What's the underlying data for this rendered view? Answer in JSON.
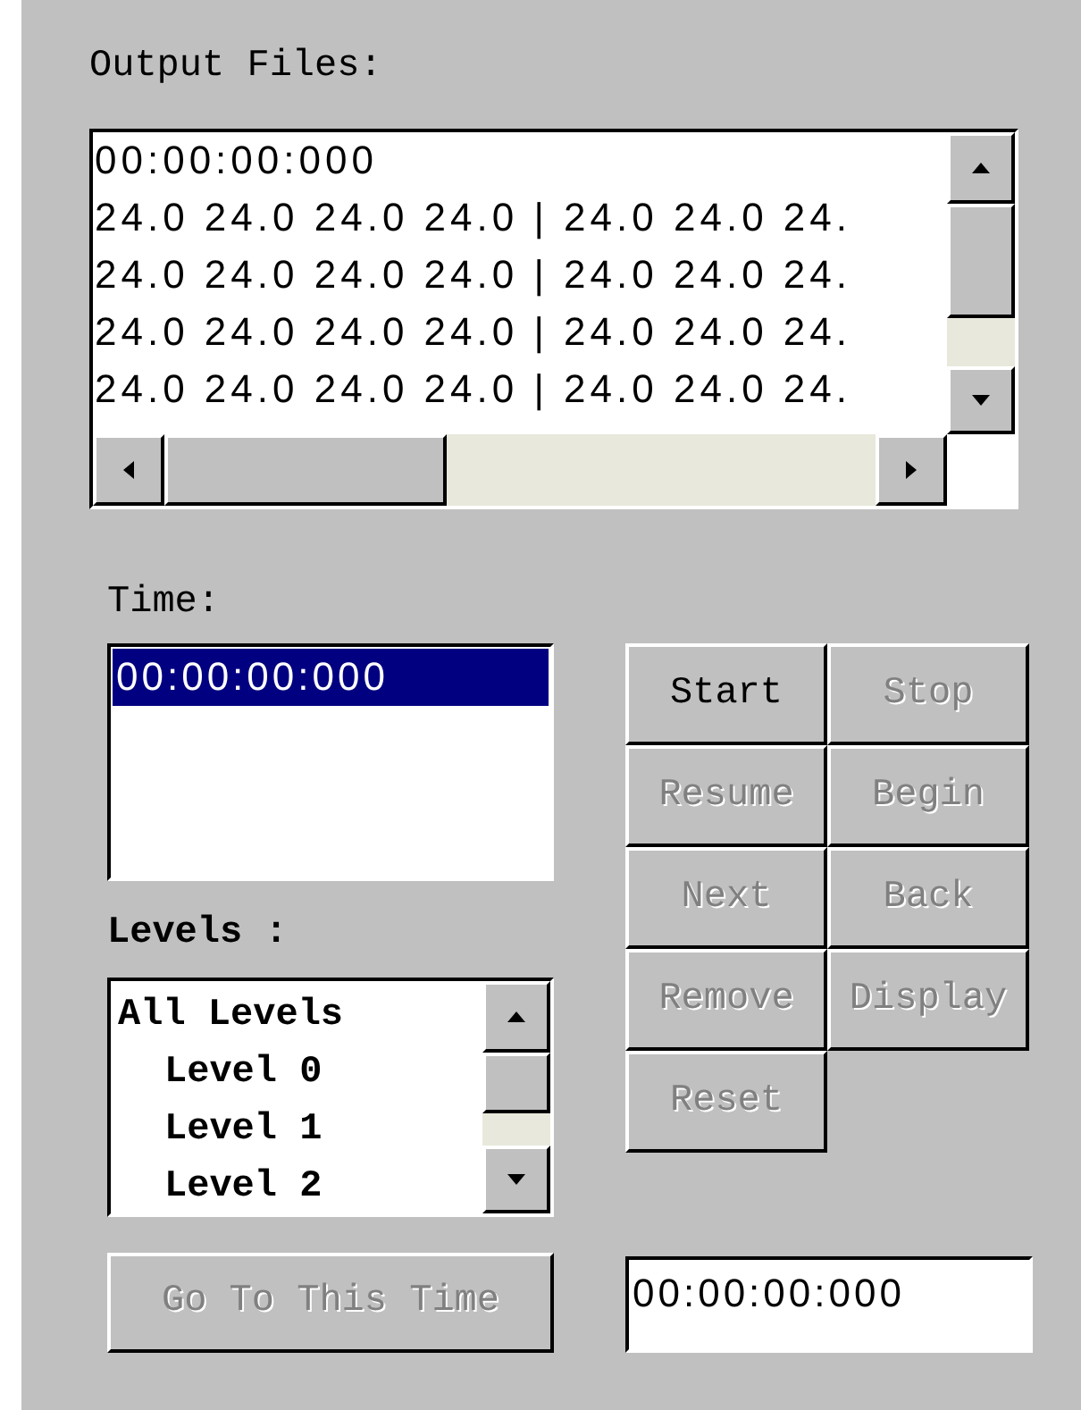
{
  "output_files": {
    "label": "Output Files:",
    "lines": [
      "00:00:00:000",
      "24.0 24.0 24.0 24.0 | 24.0 24.0 24.",
      "24.0 24.0 24.0 24.0 | 24.0 24.0 24.",
      "24.0 24.0 24.0 24.0 | 24.0 24.0 24.",
      "24.0 24.0 24.0 24.0 | 24.0 24.0 24."
    ]
  },
  "time": {
    "label": "Time:",
    "items": [
      {
        "text": "00:00:00:000",
        "selected": true
      }
    ]
  },
  "levels": {
    "label": "Levels :",
    "items": [
      {
        "text": "All Levels",
        "children": [
          {
            "text": "Level 0"
          },
          {
            "text": "Level 1"
          },
          {
            "text": "Level 2"
          }
        ]
      }
    ]
  },
  "buttons": [
    {
      "label": "Start",
      "disabled": false
    },
    {
      "label": "Stop",
      "disabled": true
    },
    {
      "label": "Resume",
      "disabled": true
    },
    {
      "label": "Begin",
      "disabled": true
    },
    {
      "label": "Next",
      "disabled": true
    },
    {
      "label": "Back",
      "disabled": true
    },
    {
      "label": "Remove",
      "disabled": true
    },
    {
      "label": "Display",
      "disabled": true
    },
    {
      "label": "Reset",
      "disabled": true
    }
  ],
  "go_button": {
    "label": "Go To This Time",
    "disabled": true
  },
  "time_field": {
    "value": "00:00:00:000"
  }
}
